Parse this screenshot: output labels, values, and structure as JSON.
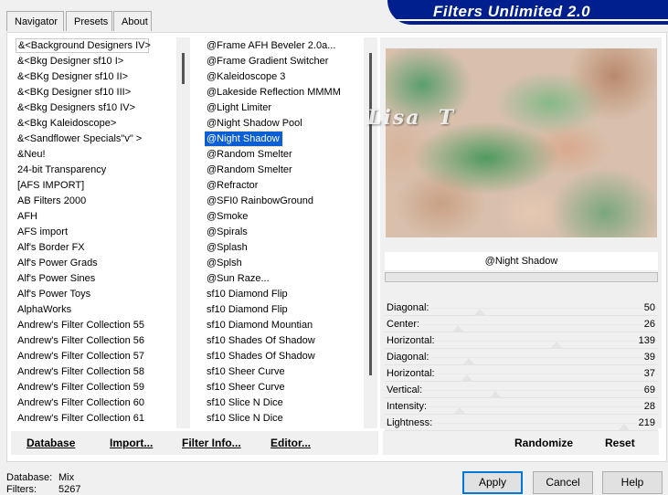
{
  "window": {
    "title": "Filters Unlimited 2.0"
  },
  "tabs": [
    {
      "label": "Navigator",
      "active": true
    },
    {
      "label": "Presets",
      "active": false
    },
    {
      "label": "About",
      "active": false
    }
  ],
  "categories": {
    "items": [
      "&<Background Designers IV>",
      "&<Bkg Designer sf10 I>",
      "&<BKg Designer sf10 II>",
      "&<BKg Designer sf10 III>",
      "&<Bkg Designers sf10 IV>",
      "&<Bkg Kaleidoscope>",
      "&<Sandflower Specials\"v\" >",
      "&Neu!",
      "24-bit Transparency",
      "[AFS IMPORT]",
      "AB Filters 2000",
      "AFH",
      "AFS import",
      "Alf's Border FX",
      "Alf's Power Grads",
      "Alf's Power Sines",
      "Alf's Power Toys",
      "AlphaWorks",
      "Andrew's Filter Collection 55",
      "Andrew's Filter Collection 56",
      "Andrew's Filter Collection 57",
      "Andrew's Filter Collection 58",
      "Andrew's Filter Collection 59",
      "Andrew's Filter Collection 60",
      "Andrew's Filter Collection 61"
    ],
    "selected_index": 0
  },
  "filters": {
    "items": [
      "@Frame AFH Beveler 2.0a...",
      "@Frame Gradient Switcher",
      "@Kaleidoscope 3",
      "@Lakeside Reflection MMMM",
      "@Light Limiter",
      "@Night Shadow Pool",
      "@Night Shadow",
      "@Random Smelter",
      "@Random Smelter",
      "@Refractor",
      "@SFI0 RainbowGround",
      "@Smoke",
      "@Spirals",
      "@Splash",
      "@Splsh",
      "@Sun Raze...",
      "sf10 Diamond Flip",
      "sf10 Diamond Flip",
      "sf10 Diamond Mountian",
      "sf10 Shades Of Shadow",
      "sf10 Shades Of Shadow",
      "sf10 Sheer Curve",
      "sf10 Sheer Curve",
      "sf10 Slice N Dice",
      "sf10 Slice N Dice"
    ],
    "selected_index": 6
  },
  "preview": {
    "filter_name": "@Night Shadow",
    "watermark": "Lisa  T",
    "progress": 0
  },
  "sliders": [
    {
      "label": "Diagonal:",
      "value": "50",
      "level": 0.2
    },
    {
      "label": "Center:",
      "value": "26",
      "level": 0.1
    },
    {
      "label": "Horizontal:",
      "value": "139",
      "level": 0.55
    },
    {
      "label": "Diagonal:",
      "value": "39",
      "level": 0.15
    },
    {
      "label": "Horizontal:",
      "value": "37",
      "level": 0.14
    },
    {
      "label": "Vertical:",
      "value": "69",
      "level": 0.27
    },
    {
      "label": "Intensity:",
      "value": "28",
      "level": 0.11
    },
    {
      "label": "Lightness:",
      "value": "219",
      "level": 0.86
    }
  ],
  "toolbar": {
    "database": "Database",
    "import": "Import...",
    "filter_info": "Filter Info...",
    "editor": "Editor...",
    "randomize": "Randomize",
    "reset": "Reset"
  },
  "status": {
    "database_label": "Database:",
    "database_value": "Mix",
    "filters_label": "Filters:",
    "filters_value": "5267"
  },
  "buttons": {
    "apply": "Apply",
    "cancel": "Cancel",
    "help": "Help"
  },
  "colors": {
    "banner": "#001f8f",
    "selection": "#0a5ed6",
    "progress": "#06b025"
  }
}
